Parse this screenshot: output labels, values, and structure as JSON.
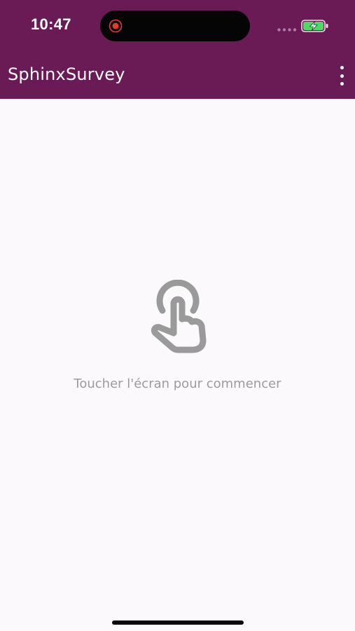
{
  "status_bar": {
    "time": "10:47",
    "recording_icon": "record-icon",
    "signal_icon": "cellular-signal-icon",
    "battery_icon": "battery-charging-icon",
    "battery_color": "#4cd964"
  },
  "app_bar": {
    "title": "SphinxSurvey",
    "menu_icon": "more-vertical-icon",
    "background_color": "#6a1a55"
  },
  "main": {
    "icon": "touch-hand-icon",
    "prompt": "Toucher l'écran pour commencer"
  }
}
